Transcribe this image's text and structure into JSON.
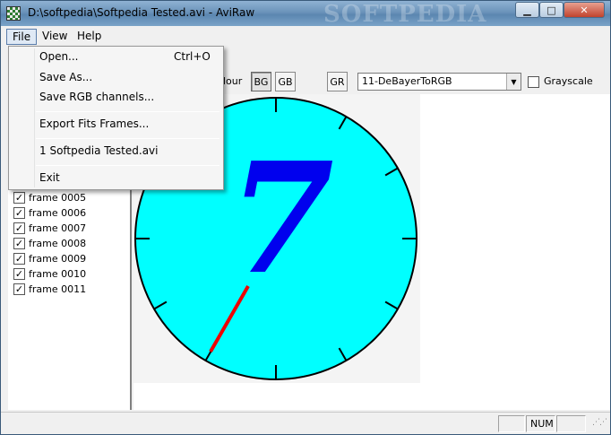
{
  "window": {
    "title": "D:\\softpedia\\Softpedia Tested.avi - AviRaw",
    "watermark": "SOFTPEDIA",
    "controls": {
      "minimize": "▁",
      "maximize": "□",
      "close": "✕"
    }
  },
  "menubar": {
    "items": [
      "File",
      "View",
      "Help"
    ],
    "open": "File"
  },
  "file_menu": {
    "items": [
      {
        "label": "Open...",
        "shortcut": "Ctrl+O"
      },
      {
        "label": "Save As..."
      },
      {
        "label": "Save RGB channels..."
      },
      {
        "label": "Export Fits Frames..."
      },
      {
        "label": "1 Softpedia Tested.avi"
      },
      {
        "label": "Exit"
      }
    ]
  },
  "toolbar": {
    "colour_label": "lour",
    "bg_label": "BG",
    "gb_label": "GB",
    "gr_label": "GR",
    "debayer_selected": "11-DeBayerToRGB",
    "grayscale_label": "Grayscale",
    "grayscale_checked": false
  },
  "frames": [
    {
      "label": "frame 0005",
      "checked": true
    },
    {
      "label": "frame 0006",
      "checked": true
    },
    {
      "label": "frame 0007",
      "checked": true
    },
    {
      "label": "frame 0008",
      "checked": true
    },
    {
      "label": "frame 0009",
      "checked": true
    },
    {
      "label": "frame 0010",
      "checked": true
    },
    {
      "label": "frame 0011",
      "checked": true
    }
  ],
  "preview": {
    "digit": "7",
    "colors": {
      "dial": "#00ffff",
      "digit": "#0000ee",
      "hand": "#ee0000"
    }
  },
  "statusbar": {
    "num": "NUM"
  }
}
